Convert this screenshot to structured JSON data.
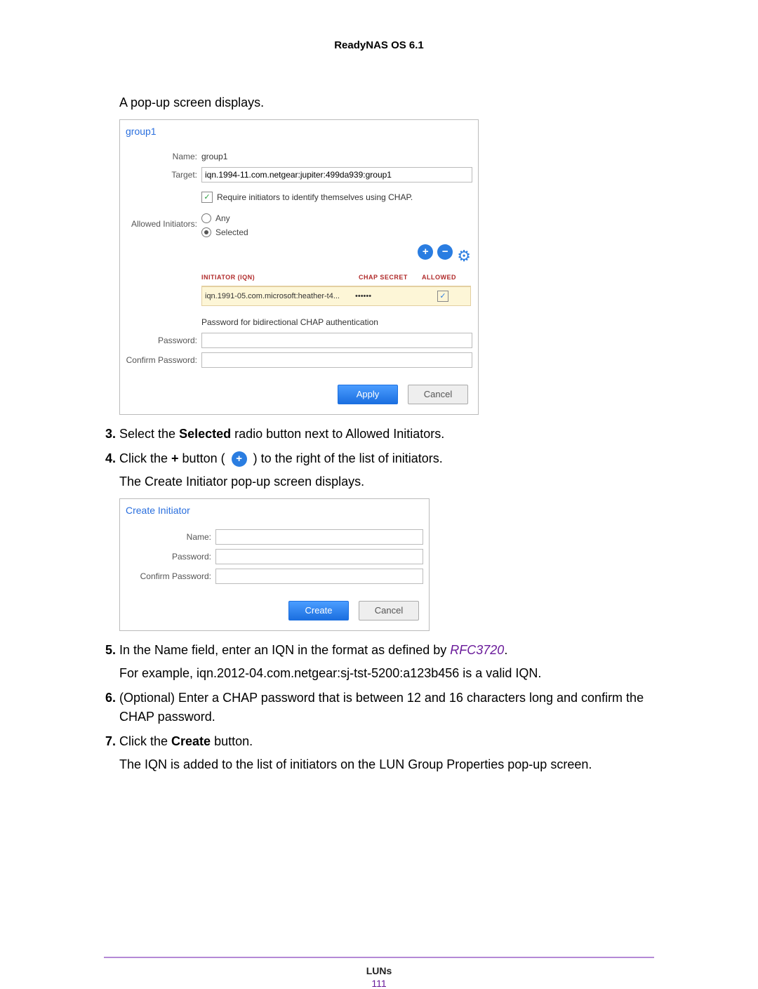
{
  "doc_header": "ReadyNAS OS 6.1",
  "intro_text": "A pop-up screen displays.",
  "popup1": {
    "title": "group1",
    "name_label": "Name:",
    "name_value": "group1",
    "target_label": "Target:",
    "target_value": "iqn.1994-11.com.netgear:jupiter:499da939:group1",
    "chap_checkbox_label": "Require initiators to identify themselves using CHAP.",
    "allowed_label": "Allowed Initiators:",
    "radio_any": "Any",
    "radio_selected": "Selected",
    "table": {
      "col_iqn": "INITIATOR (IQN)",
      "col_secret": "CHAP SECRET",
      "col_allowed": "ALLOWED",
      "row_iqn": "iqn.1991-05.com.microsoft:heather-t4...",
      "row_secret": "••••••"
    },
    "chap_note": "Password for bidirectional CHAP authentication",
    "password_label": "Password:",
    "confirm_label": "Confirm Password:",
    "apply": "Apply",
    "cancel": "Cancel"
  },
  "steps": {
    "s3_a": "Select the ",
    "s3_bold": "Selected",
    "s3_b": " radio button next to Allowed Initiators.",
    "s4_a": "Click the ",
    "s4_plus": "+",
    "s4_b": " button ( ",
    "s4_c": " ) to the right of the list of initiators.",
    "s4_sub": "The Create Initiator pop-up screen displays.",
    "s5_a": "In the Name field, enter an IQN in the format as defined by ",
    "s5_rfc": "RFC3720",
    "s5_b": ".",
    "s5_sub": "For example, iqn.2012-04.com.netgear:sj-tst-5200:a123b456 is a valid IQN.",
    "s6": "(Optional) Enter a CHAP password that is between 12 and 16 characters long and confirm the CHAP password.",
    "s7_a": "Click the ",
    "s7_bold": "Create",
    "s7_b": " button.",
    "s7_sub": "The IQN is added to the list of initiators on the LUN Group Properties pop-up screen."
  },
  "popup2": {
    "title": "Create Initiator",
    "name_label": "Name:",
    "password_label": "Password:",
    "confirm_label": "Confirm Password:",
    "create": "Create",
    "cancel": "Cancel"
  },
  "footer": {
    "title": "LUNs",
    "page": "111"
  }
}
